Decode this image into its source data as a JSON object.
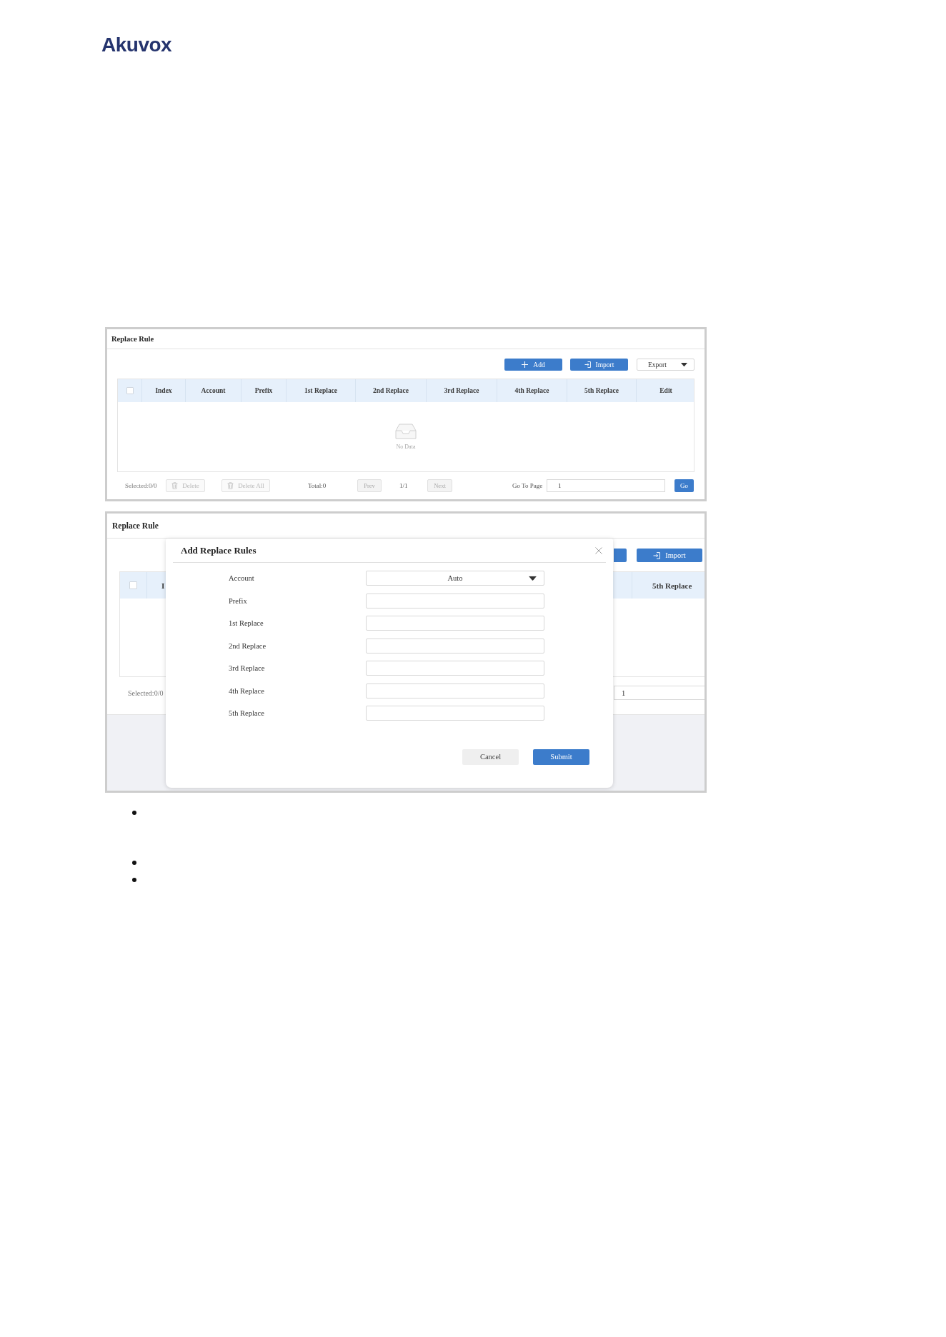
{
  "logo": {
    "text": "Akuvox"
  },
  "screen_1": {
    "title": "Replace Rule",
    "toolbar": {
      "add_button": "Add",
      "import_button": "Import",
      "export_menu": "Export"
    },
    "table": {
      "select_all_checked": false,
      "columns": [
        "Index",
        "Account",
        "Prefix",
        "1st Replace",
        "2nd Replace",
        "3rd Replace",
        "4th Replace",
        "5th Replace",
        "Edit"
      ],
      "empty_text": "No Data"
    },
    "footer": {
      "selected": "Selected:0/0",
      "delete_button": {
        "label": "Delete",
        "disabled": true
      },
      "delete_all_button": {
        "label": "Delete All",
        "disabled": true
      },
      "total": "Total:0",
      "prev_button": {
        "label": "Prev",
        "disabled": true
      },
      "page": "1/1",
      "next_button": {
        "label": "Next",
        "disabled": true
      },
      "go_to_label": "Go To Page",
      "page_field": {
        "value": "1"
      },
      "go_button": "Go"
    }
  },
  "screen_2": {
    "title": "Replace Rule",
    "toolbar": {
      "import_button": "Import"
    },
    "table": {
      "select_all_checked": false,
      "columns": [
        "I",
        "5th Replace"
      ]
    },
    "footer": {
      "selected": "Selected:0/0",
      "page_field": {
        "value": "1"
      }
    },
    "dialog": {
      "title": "Add Replace Rules",
      "fields": [
        {
          "label": "Account",
          "kind": "select",
          "value": "Auto"
        },
        {
          "label": "Prefix",
          "kind": "text"
        },
        {
          "label": "1st Replace",
          "kind": "text"
        },
        {
          "label": "2nd Replace",
          "kind": "text"
        },
        {
          "label": "3rd Replace",
          "kind": "text"
        },
        {
          "label": "4th Replace",
          "kind": "text"
        },
        {
          "label": "5th Replace",
          "kind": "text"
        }
      ],
      "cancel_button": "Cancel",
      "submit_button": "Submit"
    }
  },
  "bullets": [
    {
      "kind": "dot"
    },
    {
      "kind": "dot"
    },
    {
      "kind": "dot"
    }
  ]
}
